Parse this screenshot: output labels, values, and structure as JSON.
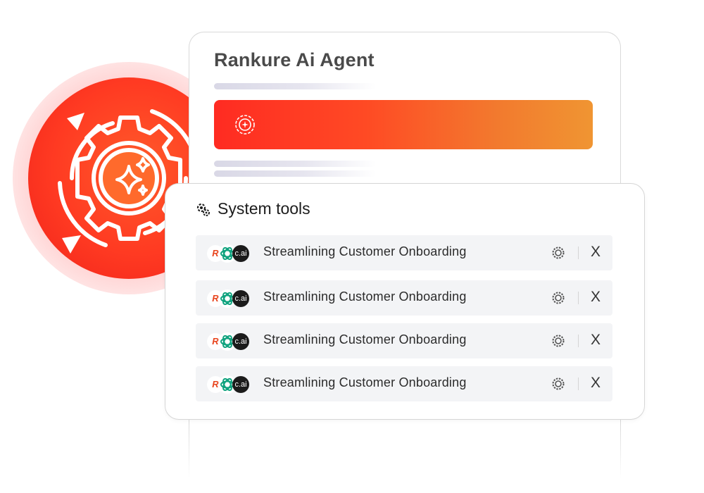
{
  "agent_card": {
    "title": "Rankure Ai Agent"
  },
  "system_tools": {
    "title": "System tools",
    "items": [
      {
        "label": "Streamlining Customer Onboarding",
        "logos": [
          "R",
          "openai-icon",
          "c.ai"
        ],
        "close_label": "X"
      },
      {
        "label": "Streamlining Customer Onboarding",
        "logos": [
          "R",
          "openai-icon",
          "c.ai"
        ],
        "close_label": "X"
      },
      {
        "label": "Streamlining Customer Onboarding",
        "logos": [
          "R",
          "openai-icon",
          "c.ai"
        ],
        "close_label": "X"
      },
      {
        "label": "Streamlining Customer Onboarding",
        "logos": [
          "R",
          "openai-icon",
          "c.ai"
        ],
        "close_label": "X"
      }
    ]
  },
  "colors": {
    "accent_red": "#ff2b22",
    "accent_orange": "#f09532",
    "row_bg": "#f3f4f6",
    "openai_green": "#10a37f"
  }
}
